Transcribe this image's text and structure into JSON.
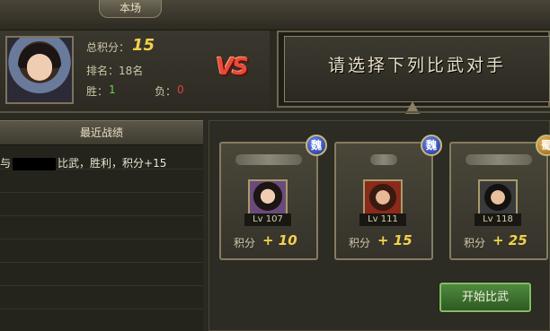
{
  "top_tab": "本场",
  "player": {
    "score_label": "总积分：",
    "score_value": "15",
    "rank": "排名：18名",
    "win_label": "胜：",
    "win_value": "1",
    "lose_label": "负：",
    "lose_value": "0"
  },
  "vs_label": "VS",
  "prompt": "请选择下列比武对手",
  "recent": {
    "title": "最近战绩",
    "entry_prefix": "与",
    "entry_suffix": "比武，胜利，积分+15"
  },
  "opponents": [
    {
      "faction": "魏",
      "level": "Lv 107",
      "pts_label": "积分",
      "pts": "+ 10"
    },
    {
      "faction": "魏",
      "level": "Lv 111",
      "pts_label": "积分",
      "pts": "+ 15"
    },
    {
      "faction": "蜀",
      "level": "Lv 118",
      "pts_label": "积分",
      "pts": "+ 25"
    }
  ],
  "start_button": "开始比武",
  "colors": {
    "score": "#f2d24a",
    "win": "#6ad24a",
    "lose": "#e04040",
    "vs": "#e94a3a",
    "button": "#3e7a32"
  }
}
